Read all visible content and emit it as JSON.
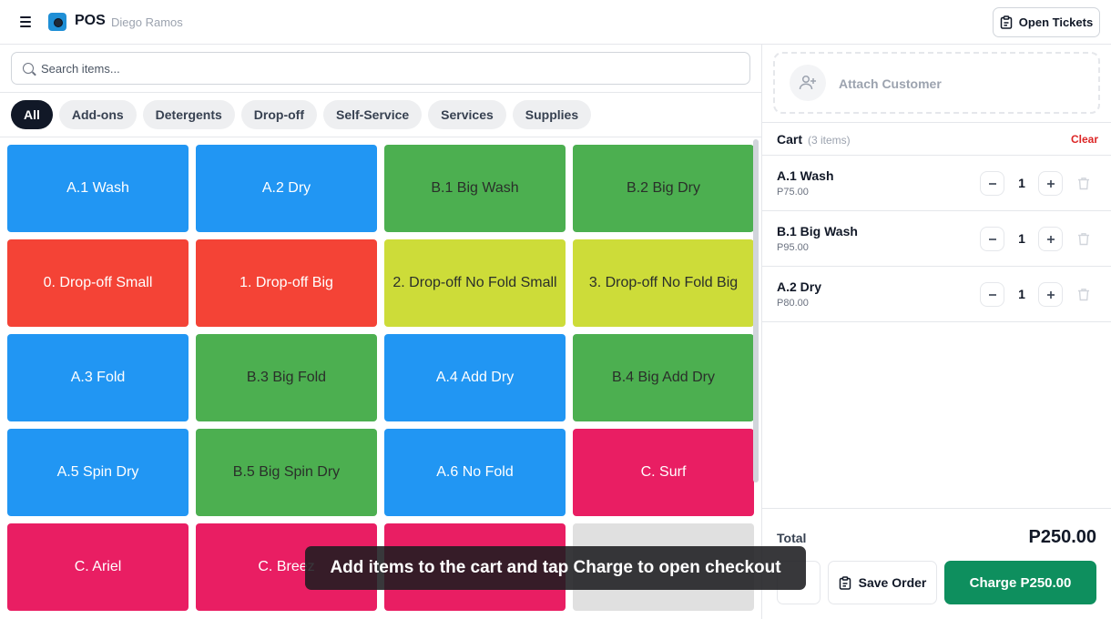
{
  "header": {
    "app_title": "POS",
    "user_name": "Diego Ramos",
    "open_tickets_label": "Open Tickets"
  },
  "search": {
    "placeholder": "Search items..."
  },
  "categories": [
    {
      "label": "All",
      "active": true
    },
    {
      "label": "Add-ons",
      "active": false
    },
    {
      "label": "Detergents",
      "active": false
    },
    {
      "label": "Drop-off",
      "active": false
    },
    {
      "label": "Self-Service",
      "active": false
    },
    {
      "label": "Services",
      "active": false
    },
    {
      "label": "Supplies",
      "active": false
    }
  ],
  "items": [
    {
      "label": "A.1 Wash",
      "color": "#2196f3"
    },
    {
      "label": "A.2 Dry",
      "color": "#2196f3"
    },
    {
      "label": "B.1 Big Wash",
      "color": "#4caf50"
    },
    {
      "label": "B.2 Big Dry",
      "color": "#4caf50"
    },
    {
      "label": "0. Drop-off Small",
      "color": "#f44336"
    },
    {
      "label": "1. Drop-off Big",
      "color": "#f44336"
    },
    {
      "label": "2. Drop-off No Fold Small",
      "color": "#cddc39"
    },
    {
      "label": "3. Drop-off No Fold Big",
      "color": "#cddc39"
    },
    {
      "label": "A.3 Fold",
      "color": "#2196f3"
    },
    {
      "label": "B.3 Big Fold",
      "color": "#4caf50"
    },
    {
      "label": "A.4 Add Dry",
      "color": "#2196f3"
    },
    {
      "label": "B.4 Big Add Dry",
      "color": "#4caf50"
    },
    {
      "label": "A.5 Spin Dry",
      "color": "#2196f3"
    },
    {
      "label": "B.5 Big Spin Dry",
      "color": "#4caf50"
    },
    {
      "label": "A.6 No Fold",
      "color": "#2196f3"
    },
    {
      "label": "C. Surf",
      "color": "#e91e63"
    },
    {
      "label": "C. Ariel",
      "color": "#e91e63"
    },
    {
      "label": "C. Breez",
      "color": "#e91e63"
    },
    {
      "label": "",
      "color": "#e91e63"
    },
    {
      "label": "",
      "color": "#e0e0e0"
    }
  ],
  "toast": {
    "message": "Add items to the cart and tap Charge to open checkout"
  },
  "customer": {
    "attach_label": "Attach Customer"
  },
  "cart": {
    "title": "Cart",
    "count_label": "(3 items)",
    "clear_label": "Clear",
    "lines": [
      {
        "name": "A.1 Wash",
        "price": "P75.00",
        "qty": "1"
      },
      {
        "name": "B.1 Big Wash",
        "price": "P95.00",
        "qty": "1"
      },
      {
        "name": "A.2 Dry",
        "price": "P80.00",
        "qty": "1"
      }
    ],
    "total_label": "Total",
    "total_value": "P250.00",
    "save_order_label": "Save Order",
    "charge_label": "Charge P250.00"
  }
}
